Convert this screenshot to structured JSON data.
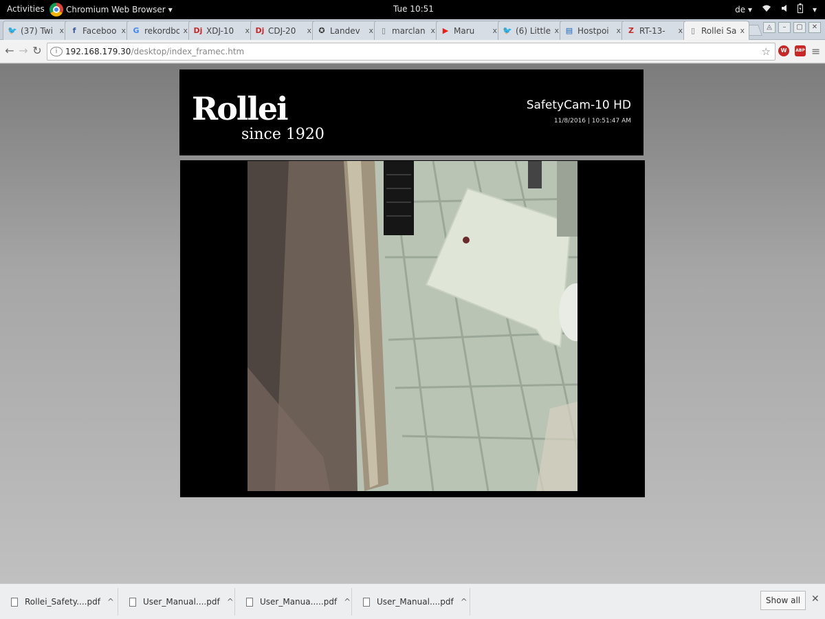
{
  "topbar": {
    "activities": "Activities",
    "app_name": "Chromium Web Browser",
    "app_caret": "▾",
    "clock": "Tue 10:51",
    "keyboard": "de ▾",
    "tray": [
      "wifi-icon",
      "volume-icon",
      "battery-icon",
      "power-menu-icon"
    ]
  },
  "tabs": [
    {
      "title": "(37) Twi",
      "icon": "twitter-icon",
      "icon_glyph": "🐦",
      "icon_color": "#1da1f2"
    },
    {
      "title": "Faceboo",
      "icon": "facebook-icon",
      "icon_glyph": "f",
      "icon_color": "#3b5998"
    },
    {
      "title": "rekordbo",
      "icon": "google-icon",
      "icon_glyph": "G",
      "icon_color": "#4285f4"
    },
    {
      "title": "XDJ-10",
      "icon": "dj-icon",
      "icon_glyph": "Dj",
      "icon_color": "#c62828"
    },
    {
      "title": "CDJ-20",
      "icon": "dj-icon",
      "icon_glyph": "Dj",
      "icon_color": "#c62828"
    },
    {
      "title": "Landev",
      "icon": "wheel-icon",
      "icon_glyph": "✪",
      "icon_color": "#333333"
    },
    {
      "title": "marclan",
      "icon": "page-icon",
      "icon_glyph": "▯",
      "icon_color": "#777777"
    },
    {
      "title": "Maru",
      "icon": "youtube-icon",
      "icon_glyph": "▶",
      "icon_color": "#e62117"
    },
    {
      "title": "(6) Little",
      "icon": "twitter-icon",
      "icon_glyph": "🐦",
      "icon_color": "#1da1f2"
    },
    {
      "title": "Hostpoi",
      "icon": "hostpoint-icon",
      "icon_glyph": "▤",
      "icon_color": "#1565c0"
    },
    {
      "title": "RT-13-",
      "icon": "pdf-z-icon",
      "icon_glyph": "Z",
      "icon_color": "#c62828"
    },
    {
      "title": "Rollei Sa",
      "icon": "page-icon",
      "icon_glyph": "▯",
      "icon_color": "#777777",
      "active": true
    }
  ],
  "tab_close": "x",
  "window_controls": [
    "◬",
    "–",
    "▢",
    "✕"
  ],
  "toolbar": {
    "back": "←",
    "forward": "→",
    "reload": "↻",
    "url_host": "192.168.179.30",
    "url_path": "/desktop/index_framec.htm",
    "star": "☆",
    "ext1": "W",
    "ext2": "ABP",
    "menu": "≡"
  },
  "camera": {
    "brand": "Rollei",
    "since": "since 1920",
    "model": "SafetyCam-10 HD",
    "timestamp": "11/8/2016 | 10:51:47 AM"
  },
  "downloads": [
    {
      "name": "Rollei_Safety....pdf"
    },
    {
      "name": "User_Manual....pdf"
    },
    {
      "name": "User_Manua.....pdf"
    },
    {
      "name": "User_Manual....pdf"
    }
  ],
  "download_caret": "^",
  "show_all": "Show all",
  "shelf_close": "✕"
}
